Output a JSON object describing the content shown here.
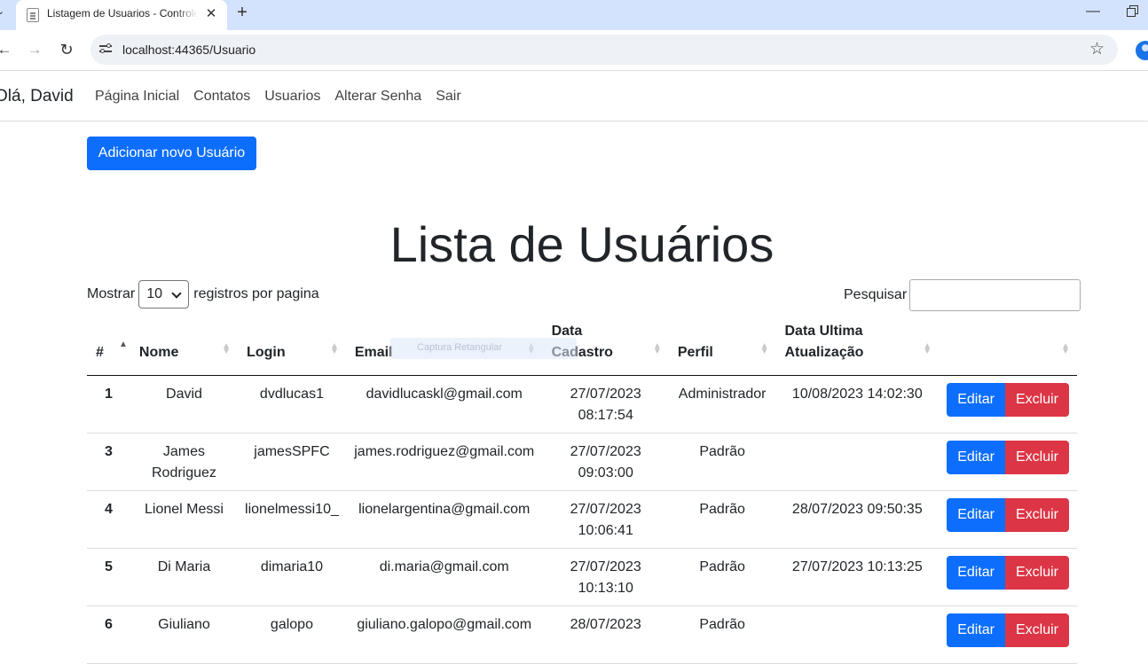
{
  "browser": {
    "tab_title": "Listagem de Usuarios - ControleContatos",
    "url": "localhost:44365/Usuario"
  },
  "navbar": {
    "greeting": "Olá, David",
    "links": [
      "Página Inicial",
      "Contatos",
      "Usuarios",
      "Alterar Senha",
      "Sair"
    ]
  },
  "page": {
    "add_button": "Adicionar novo Usuário",
    "title": "Lista de Usuários"
  },
  "table_controls": {
    "show_prefix": "Mostrar",
    "page_size": "10",
    "show_suffix": "registros por pagina",
    "search_label": "Pesquisar",
    "search_value": ""
  },
  "table": {
    "columns": [
      "#",
      "Nome",
      "Login",
      "Email",
      "Data Cadastro",
      "Perfil",
      "Data Ultima Atualização",
      ""
    ],
    "rows": [
      {
        "id": "1",
        "nome": "David",
        "login": "dvdlucas1",
        "email": "davidlucaskl@gmail.com",
        "cadastro": "27/07/2023 08:17:54",
        "perfil": "Administrador",
        "atualizacao": "10/08/2023 14:02:30"
      },
      {
        "id": "3",
        "nome": "James Rodriguez",
        "login": "jamesSPFC",
        "email": "james.rodriguez@gmail.com",
        "cadastro": "27/07/2023 09:03:00",
        "perfil": "Padrão",
        "atualizacao": ""
      },
      {
        "id": "4",
        "nome": "Lionel Messi",
        "login": "lionelmessi10_",
        "email": "lionelargentina@gmail.com",
        "cadastro": "27/07/2023 10:06:41",
        "perfil": "Padrão",
        "atualizacao": "28/07/2023 09:50:35"
      },
      {
        "id": "5",
        "nome": "Di Maria",
        "login": "dimaria10",
        "email": "di.maria@gmail.com",
        "cadastro": "27/07/2023 10:13:10",
        "perfil": "Padrão",
        "atualizacao": "27/07/2023 10:13:25"
      },
      {
        "id": "6",
        "nome": "Giuliano",
        "login": "galopo",
        "email": "giuliano.galopo@gmail.com",
        "cadastro": "28/07/2023",
        "perfil": "Padrão",
        "atualizacao": ""
      }
    ],
    "edit_label": "Editar",
    "delete_label": "Excluir"
  },
  "overlay": {
    "watermark_text": "Captura Retangular"
  }
}
